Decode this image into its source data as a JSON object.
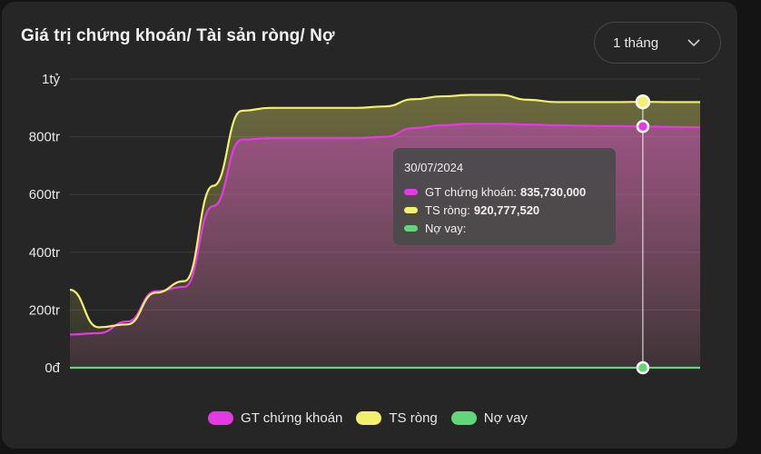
{
  "header": {
    "title": "Giá trị chứng khoán/ Tài sản ròng/ Nợ",
    "period_select": {
      "selected": "1 tháng",
      "icon": "chevron-down-icon"
    }
  },
  "colors": {
    "gt": "#e43ae4",
    "ts": "#f2f06c",
    "no": "#64d67a",
    "grid": "#3a3a3a",
    "text": "#e6e6e6"
  },
  "tooltip": {
    "date": "30/07/2024",
    "rows": [
      {
        "label": "GT chứng khoán:",
        "value": "835,730,000"
      },
      {
        "label": "TS ròng:",
        "value": "920,777,520"
      },
      {
        "label": "Nợ vay:",
        "value": ""
      }
    ]
  },
  "legend": [
    {
      "label": "GT chứng khoán"
    },
    {
      "label": "TS ròng"
    },
    {
      "label": "Nợ vay"
    }
  ],
  "chart_data": {
    "type": "area",
    "title": "Giá trị chứng khoán/ Tài sản ròng/ Nợ",
    "ylim": [
      0,
      1000000000
    ],
    "y_ticks": [
      {
        "value": 0,
        "label": "0đ"
      },
      {
        "value": 200000000,
        "label": "200tr"
      },
      {
        "value": 400000000,
        "label": "400tr"
      },
      {
        "value": 600000000,
        "label": "600tr"
      },
      {
        "value": 800000000,
        "label": "800tr"
      },
      {
        "value": 1000000000,
        "label": "1tỷ"
      }
    ],
    "x": [
      0,
      1,
      2,
      3,
      4,
      5,
      6,
      7,
      8,
      9,
      10,
      11,
      12,
      13,
      14,
      15,
      16,
      17,
      18,
      19,
      20,
      21,
      22
    ],
    "highlight_index": 20,
    "legend_position": "bottom",
    "grid": true,
    "series": [
      {
        "name": "GT chứng khoán",
        "values": [
          115000000,
          120000000,
          160000000,
          265000000,
          280000000,
          560000000,
          790000000,
          795000000,
          795000000,
          795000000,
          795000000,
          800000000,
          830000000,
          840000000,
          845000000,
          845000000,
          842000000,
          840000000,
          838000000,
          837000000,
          835730000,
          834000000,
          833000000
        ]
      },
      {
        "name": "TS ròng",
        "values": [
          270000000,
          140000000,
          150000000,
          260000000,
          300000000,
          630000000,
          890000000,
          900000000,
          900000000,
          900000000,
          900000000,
          905000000,
          930000000,
          940000000,
          945000000,
          945000000,
          928000000,
          920000000,
          920000000,
          920000000,
          920777520,
          920000000,
          920000000
        ]
      },
      {
        "name": "Nợ vay",
        "values": [
          0,
          0,
          0,
          0,
          0,
          0,
          0,
          0,
          0,
          0,
          0,
          0,
          0,
          0,
          0,
          0,
          0,
          0,
          0,
          0,
          0,
          0,
          0
        ]
      }
    ]
  }
}
